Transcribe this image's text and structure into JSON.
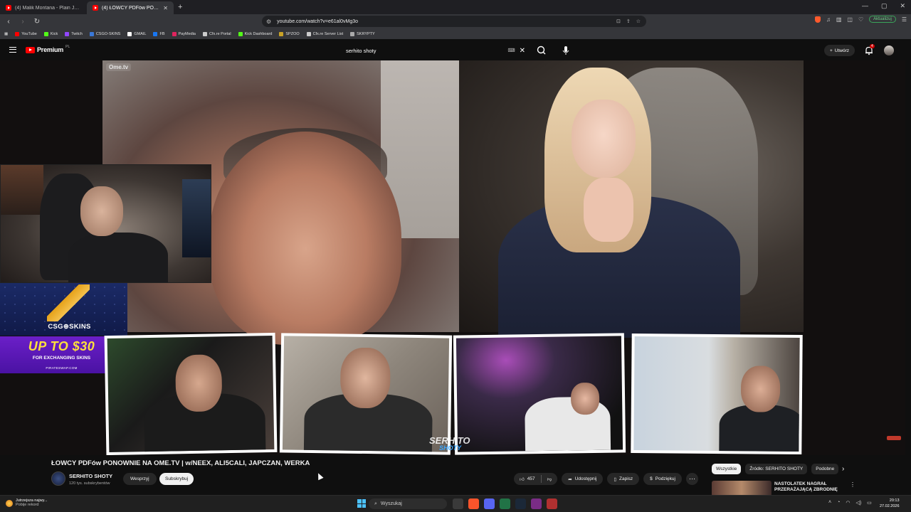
{
  "browser": {
    "tabs": [
      {
        "title": "(4) Malik Montana - Plain Jane [Offic",
        "active": false
      },
      {
        "title": "(4) ŁOWCY PDFów PONOWNI",
        "active": true
      }
    ],
    "url": "youtube.com/watch?v=e61al0vMg3o",
    "update_label": "Aktualizuj",
    "bookmarks": [
      {
        "label": "YouTube",
        "color": "#ff0000"
      },
      {
        "label": "Kick",
        "color": "#53fc18"
      },
      {
        "label": "Twitch",
        "color": "#9146ff"
      },
      {
        "label": "CSGO-SKINS",
        "color": "#3a78d8"
      },
      {
        "label": "GMAIL",
        "color": "#ffffff"
      },
      {
        "label": "FB",
        "color": "#1877f2"
      },
      {
        "label": "PayMedia",
        "color": "#e0245e"
      },
      {
        "label": "Cfx.re Portal",
        "color": "#cccccc"
      },
      {
        "label": "Kick Dashboard",
        "color": "#53fc18"
      },
      {
        "label": "SPZOO",
        "color": "#c9a227"
      },
      {
        "label": "Cfx.re Server List",
        "color": "#cccccc"
      },
      {
        "label": "SKRYPTY",
        "color": "#aaaaaa"
      }
    ]
  },
  "youtube": {
    "logo_text": "Premium",
    "logo_country": "PL",
    "search_query": "serhito shoty",
    "create_label": "Utwórz",
    "notifications_count": "4"
  },
  "video": {
    "ometv_watermark": "Ome.tv",
    "promo": {
      "brand": "CSG⊕SKINS",
      "headline": "UP TO $30",
      "subline": "FOR EXCHANGING SKINS",
      "site": "PIRATESWAP.COM"
    },
    "overlay_logo": "SERHITO",
    "overlay_logo_2": "SHOTY",
    "title": "ŁOWCY PDFów PONOWNIE NA OME.TV | w/NEEX, ALI5CALI, JAPCZAN, WERKA"
  },
  "channel": {
    "name": "SERHITO SHOTY",
    "subscribers": "120 tys. subskrybentów",
    "join_label": "Wesprzyj",
    "subscribe_label": "Subskrybuj"
  },
  "actions": {
    "likes": "457",
    "share_label": "Udostępnij",
    "save_label": "Zapisz",
    "thanks_label": "Podziękuj"
  },
  "sidebar": {
    "chips": [
      "Wszystkie",
      "Źródło: SERHITO SHOTY",
      "Podobne"
    ],
    "recommended_title": "NASTOLATEK NAGRAŁ PRZERAŻAJĄCĄ ZBRODNIĘ"
  },
  "taskbar": {
    "weather_line1": "Jutrzejsza najwy...",
    "weather_line2": "Pobije rekord",
    "search_label": "Wyszukaj",
    "time": "20:13",
    "date": "27.02.2026"
  },
  "colors": {
    "yt_red": "#ff0000",
    "background": "#0f0f0f",
    "chip_bg": "#272727",
    "promo_purple": "#6b1fc8",
    "promo_yellow": "#fde03c"
  }
}
